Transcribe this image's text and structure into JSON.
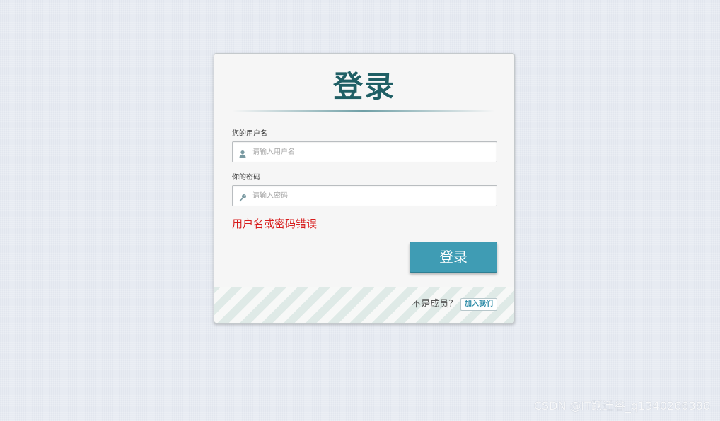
{
  "login_card": {
    "title": "登录",
    "username_label": "您的用户名",
    "username_placeholder": "请输入用户名",
    "password_label": "你的密码",
    "password_placeholder": "请输入密码",
    "error_message": "用户名或密码错误",
    "submit_label": "登录"
  },
  "footer": {
    "not_member_text": "不是成员?",
    "join_label": "加入我们"
  },
  "watermark": "CSDN @IT跃迁谷_q1340266386",
  "icons": {
    "username_icon": "user-icon",
    "password_icon": "key-icon"
  },
  "colors": {
    "title": "#1f5f65",
    "button": "#3f9cb4",
    "error": "#d81e1e",
    "join_text": "#2b8aa6"
  }
}
